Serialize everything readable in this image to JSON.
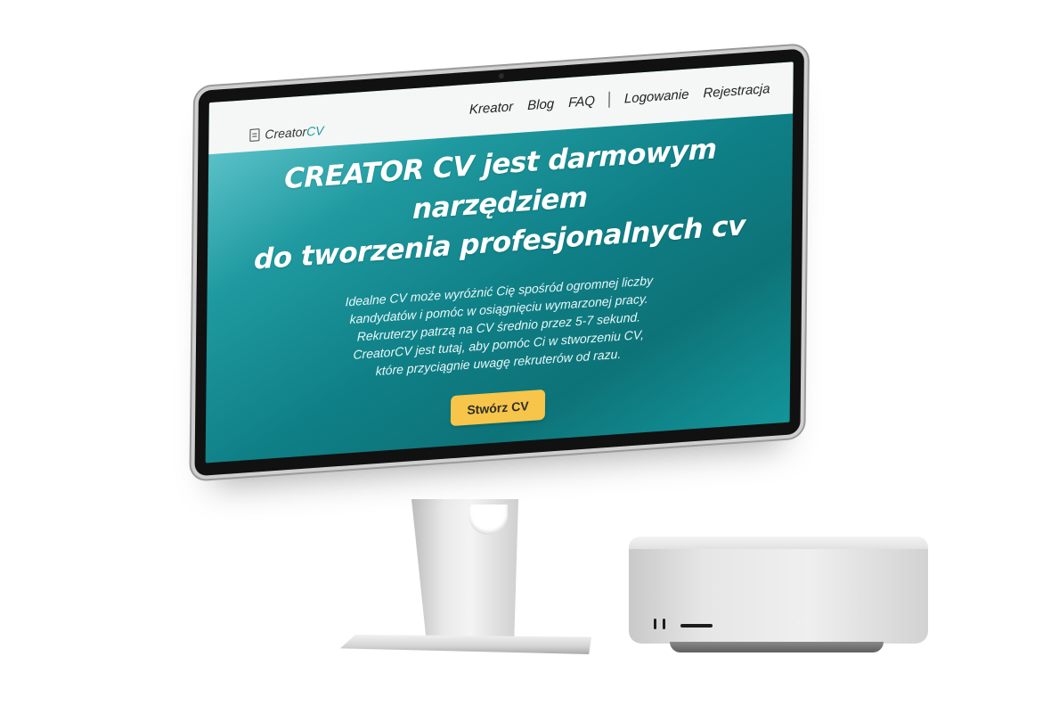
{
  "site": {
    "logo_prefix": "Creator",
    "logo_accent": "CV",
    "nav": {
      "kreator": "Kreator",
      "blog": "Blog",
      "faq": "FAQ",
      "login": "Logowanie",
      "register": "Rejestracja"
    }
  },
  "hero": {
    "title_line1": "CREATOR CV jest darmowym narzędziem",
    "title_line2": "do tworzenia profesjonalnych cv",
    "description": "Idealne CV może wyróżnić Cię spośród ogromnej liczby kandydatów i pomóc w osiągnięciu wymarzonej pracy. Rekruterzy patrzą na CV średnio przez 5-7 sekund. CreatorCV jest tutaj, aby pomóc Ci w stworzeniu CV, które przyciągnie uwagę rekruterów od razu.",
    "cta_label": "Stwórz CV"
  },
  "colors": {
    "accent": "#1a9aa0",
    "cta": "#f6c54a",
    "hero_gradient_light": "#6fcfd6",
    "hero_gradient_dark": "#0d7378"
  },
  "icons": {
    "logo": "document-icon"
  }
}
